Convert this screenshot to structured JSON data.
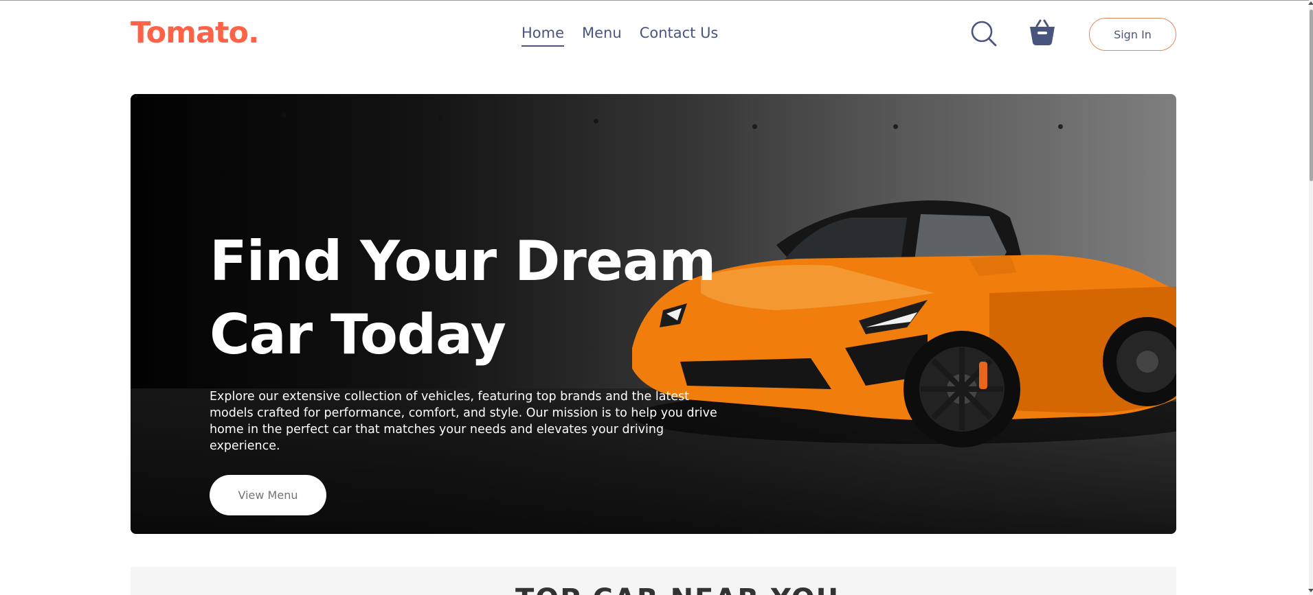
{
  "brand": {
    "logo": "Tomato.",
    "accent_color": "#ff6347",
    "text_color": "#49557e"
  },
  "nav": {
    "items": [
      {
        "label": "Home",
        "active": true
      },
      {
        "label": "Menu",
        "active": false
      },
      {
        "label": "Contact Us",
        "active": false
      }
    ],
    "search_icon": "search-icon",
    "basket_icon": "basket-icon",
    "signin_label": "Sign In"
  },
  "hero": {
    "title_line1": "Find Your Dream",
    "title_line2": "Car Today",
    "description": "Explore our extensive collection of vehicles, featuring top brands and the latest models crafted for performance, comfort, and style. Our mission is to help you drive home in the perfect car that matches your needs and elevates your driving experience.",
    "button_label": "View Menu",
    "image": "orange-sports-car-convertible"
  },
  "next_section": {
    "title": "TOP CAR NEAR YOU"
  }
}
